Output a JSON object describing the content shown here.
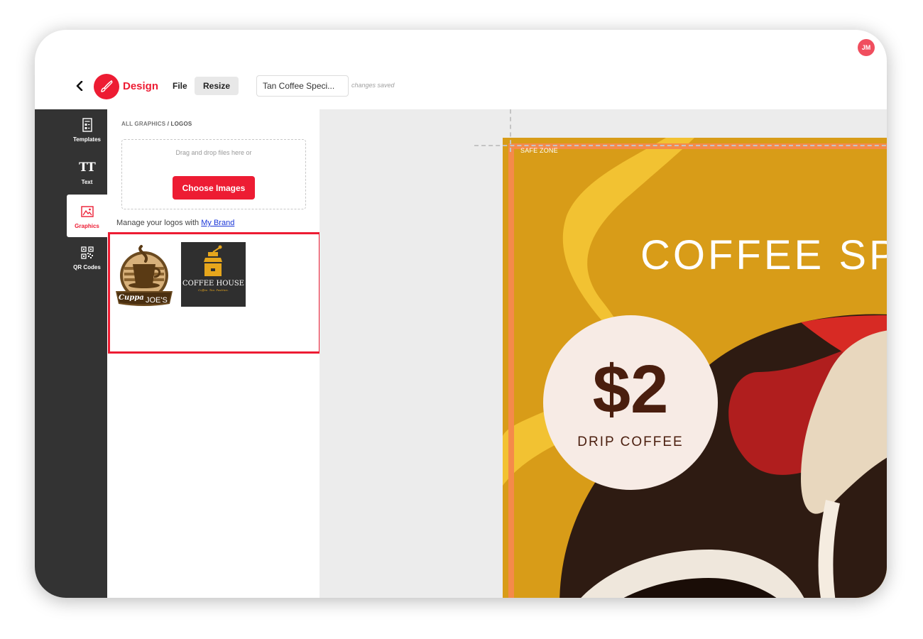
{
  "header": {
    "avatar_initials": "JM",
    "brand_label": "Design",
    "menu": {
      "file": "File",
      "resize": "Resize"
    },
    "doc_title": "Tan Coffee Speci...",
    "save_status": "changes saved"
  },
  "rail": {
    "items": [
      {
        "label": "Templates",
        "icon": "templates-icon"
      },
      {
        "label": "Text",
        "icon": "text-icon"
      },
      {
        "label": "Graphics",
        "icon": "graphics-icon",
        "active": true
      },
      {
        "label": "QR Codes",
        "icon": "qr-code-icon"
      }
    ],
    "text_glyph": "TT"
  },
  "panel": {
    "breadcrumb_root": "ALL GRAPHICS",
    "breadcrumb_sep": " / ",
    "breadcrumb_current": "LOGOS",
    "drop_text": "Drag and drop files here or",
    "choose_button": "Choose Images",
    "manage_text": "Manage your logos with ",
    "manage_link": "My Brand",
    "logos": [
      {
        "name": "Cuppa Joe's",
        "line1": "Cuppa",
        "line2": "JOE'S"
      },
      {
        "name": "Coffee House",
        "line1": "COFFEE HOUSE",
        "line2": "Coffee. Tea. Pastries."
      }
    ]
  },
  "canvas": {
    "safe_zone_label": "SAFE ZONE",
    "headline": "COFFEE SP",
    "price": "$2",
    "product": "DRIP COFFEE"
  },
  "colors": {
    "accent": "#ed1c33",
    "rail_bg": "#333333",
    "artboard_bg": "#d89c18",
    "safe_zone": "#f58a4a",
    "price_text": "#4a1e0e"
  }
}
